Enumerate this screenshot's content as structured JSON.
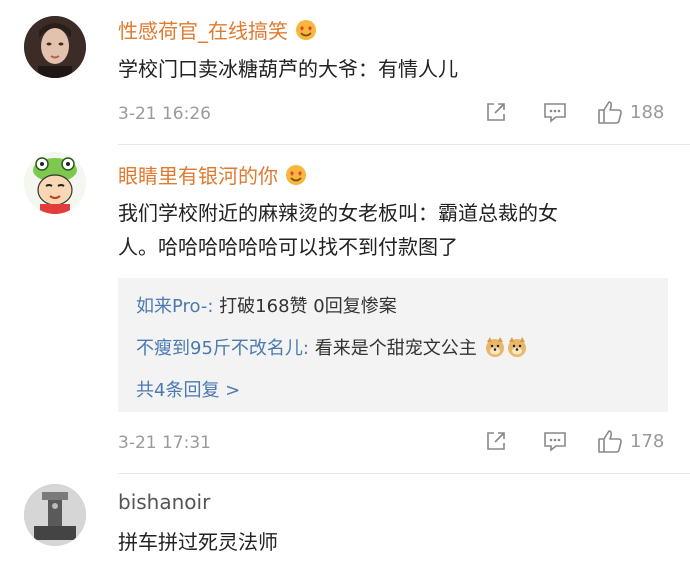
{
  "comments": [
    {
      "username": "性感荷官_在线搞笑",
      "text": "学校门口卖冰糖葫芦的大爷：有情人儿",
      "time": "3-21 16:26",
      "likes": "188",
      "badge_icon": "heart-eyes-emoji-icon"
    },
    {
      "username": "眼睛里有银河的你",
      "text_line1": "我们学校附近的麻辣烫的女老板叫：霸道总裁的女",
      "text_line2": "人。哈哈哈哈哈哈可以找不到付款图了",
      "time": "3-21 17:31",
      "likes": "178",
      "badge_icon": "heart-eyes-emoji-icon",
      "replies": [
        {
          "user": "如来Pro-:",
          "text": " 打破168赞 0回复惨案"
        },
        {
          "user": "不瘦到95斤不改名儿:",
          "text": " 看来是个甜宠文公主"
        }
      ],
      "more_replies": "共4条回复 >"
    },
    {
      "username": "bishanoir",
      "text": "拼车拼过死灵法师"
    }
  ],
  "colors": {
    "username_orange": "#e07a2f",
    "reply_blue": "#4a7ab0",
    "meta_gray": "#9a9a9a",
    "reply_bg": "#f3f3f3"
  }
}
